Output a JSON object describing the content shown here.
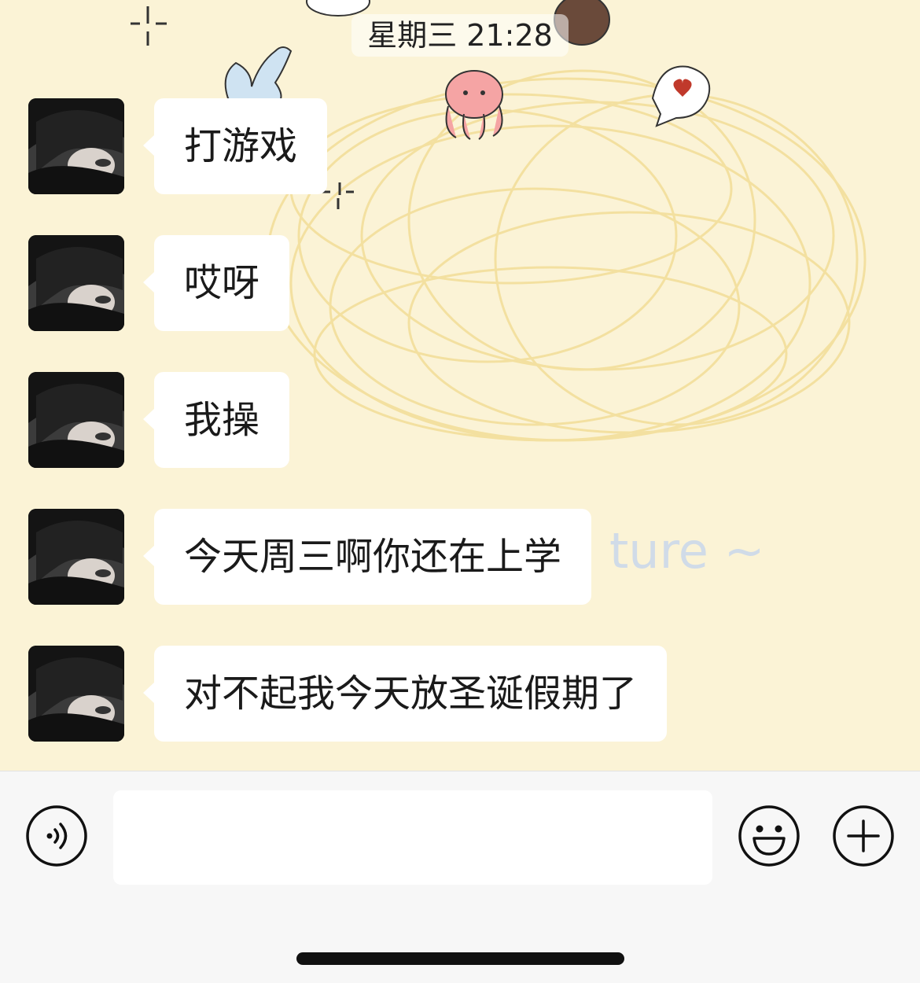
{
  "chat": {
    "timestamp": "星期三 21:28",
    "wallpaper_text": "ture ~",
    "messages": [
      {
        "text": "打游戏"
      },
      {
        "text": "哎呀"
      },
      {
        "text": "我操"
      },
      {
        "text": "今天周三啊你还在上学"
      },
      {
        "text": "对不起我今天放圣诞假期了"
      }
    ]
  },
  "input_bar": {
    "text_value": "",
    "voice_icon": "voice-icon",
    "emoji_icon": "emoji-icon",
    "add_icon": "plus-icon"
  },
  "colors": {
    "wallpaper": "#fbf3d6",
    "bubble": "#ffffff",
    "input_bar": "#f7f7f7"
  }
}
